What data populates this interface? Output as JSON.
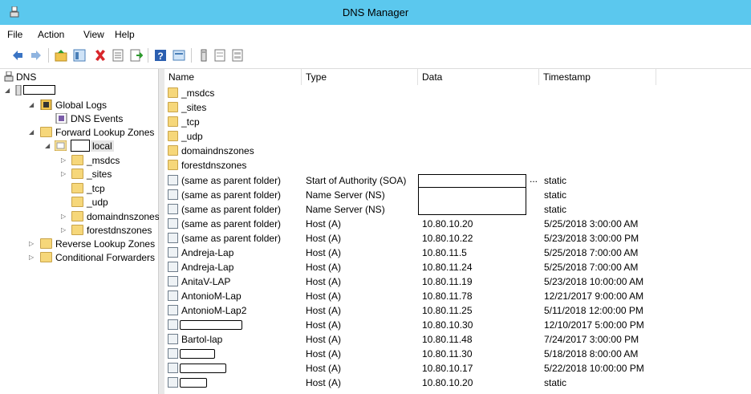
{
  "window": {
    "title": "DNS Manager"
  },
  "menu": [
    "File",
    "Action",
    "View",
    "Help"
  ],
  "toolbar_icons": [
    "back-arrow-icon",
    "forward-arrow-icon",
    "up-folder-icon",
    "show-hide-tree-icon",
    "delete-icon",
    "properties-icon",
    "export-icon",
    "help-icon",
    "console-icon",
    "server-icon",
    "list-icon",
    "details-icon"
  ],
  "tree": {
    "root": "DNS",
    "server": "",
    "global_logs": "Global Logs",
    "dns_events": "DNS Events",
    "forward_zones": "Forward Lookup Zones",
    "zone_suffix": "local",
    "zone_children": [
      "_msdcs",
      "_sites",
      "_tcp",
      "_udp",
      "domaindnszones",
      "forestdnszones"
    ],
    "reverse_zones": "Reverse Lookup Zones",
    "conditional_forwarders": "Conditional Forwarders"
  },
  "columns": [
    "Name",
    "Type",
    "Data",
    "Timestamp"
  ],
  "folders": [
    "_msdcs",
    "_sites",
    "_tcp",
    "_udp",
    "domaindnszones",
    "forestdnszones"
  ],
  "records": [
    {
      "name": "(same as parent folder)",
      "type": "Start of Authority (SOA)",
      "data": "...",
      "timestamp": "static"
    },
    {
      "name": "(same as parent folder)",
      "type": "Name Server (NS)",
      "data": "",
      "timestamp": "static"
    },
    {
      "name": "(same as parent folder)",
      "type": "Name Server (NS)",
      "data": "",
      "timestamp": "static"
    },
    {
      "name": "(same as parent folder)",
      "type": "Host (A)",
      "data": "10.80.10.20",
      "timestamp": "5/25/2018 3:00:00 AM"
    },
    {
      "name": "(same as parent folder)",
      "type": "Host (A)",
      "data": "10.80.10.22",
      "timestamp": "5/23/2018 3:00:00 PM"
    },
    {
      "name": "Andreja-Lap",
      "type": "Host (A)",
      "data": "10.80.11.5",
      "timestamp": "5/25/2018 7:00:00 AM"
    },
    {
      "name": "Andreja-Lap",
      "type": "Host (A)",
      "data": "10.80.11.24",
      "timestamp": "5/25/2018 7:00:00 AM"
    },
    {
      "name": "AnitaV-LAP",
      "type": "Host (A)",
      "data": "10.80.11.19",
      "timestamp": "5/23/2018 10:00:00 AM"
    },
    {
      "name": "AntonioM-Lap",
      "type": "Host (A)",
      "data": "10.80.11.78",
      "timestamp": "12/21/2017 9:00:00 AM"
    },
    {
      "name": "AntonioM-Lap2",
      "type": "Host (A)",
      "data": "10.80.11.25",
      "timestamp": "5/11/2018 12:00:00 PM"
    },
    {
      "name": "",
      "type": "Host (A)",
      "data": "10.80.10.30",
      "timestamp": "12/10/2017 5:00:00 PM"
    },
    {
      "name": "Bartol-lap",
      "type": "Host (A)",
      "data": "10.80.11.48",
      "timestamp": "7/24/2017 3:00:00 PM"
    },
    {
      "name": "",
      "type": "Host (A)",
      "data": "10.80.11.30",
      "timestamp": "5/18/2018 8:00:00 AM"
    },
    {
      "name": "",
      "type": "Host (A)",
      "data": "10.80.10.17",
      "timestamp": "5/22/2018 10:00:00 PM"
    },
    {
      "name": "",
      "type": "Host (A)",
      "data": "10.80.10.20",
      "timestamp": "static"
    }
  ]
}
